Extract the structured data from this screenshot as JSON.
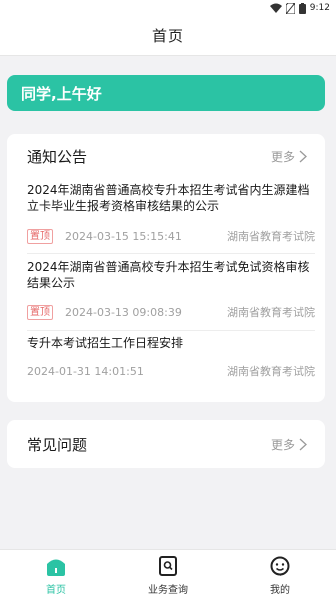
{
  "status_bar": {
    "time": "9:12"
  },
  "nav": {
    "title": "首页"
  },
  "greeting": {
    "text": "同学,上午好"
  },
  "notice_section": {
    "title": "通知公告",
    "more_label": "更多",
    "items": [
      {
        "title": "2024年湖南省普通高校专升本招生考试省内生源建档立卡毕业生报考资格审核结果的公示",
        "pinned": true,
        "pin_label": "置顶",
        "datetime": "2024-03-15 15:15:41",
        "source": "湖南省教育考试院"
      },
      {
        "title": "2024年湖南省普通高校专升本招生考试免试资格审核结果公示",
        "pinned": true,
        "pin_label": "置顶",
        "datetime": "2024-03-13 09:08:39",
        "source": "湖南省教育考试院"
      },
      {
        "title": "专升本考试招生工作日程安排",
        "pinned": false,
        "pin_label": "",
        "datetime": "2024-01-31 14:01:51",
        "source": "湖南省教育考试院"
      }
    ]
  },
  "faq_section": {
    "title": "常见问题",
    "more_label": "更多"
  },
  "tab_bar": {
    "items": [
      {
        "label": "首页",
        "icon": "home-icon",
        "active": true
      },
      {
        "label": "业务查询",
        "icon": "search-doc-icon",
        "active": false
      },
      {
        "label": "我的",
        "icon": "profile-icon",
        "active": false
      }
    ]
  },
  "colors": {
    "accent": "#2bc3a4",
    "pin_red": "#e66a6a"
  }
}
